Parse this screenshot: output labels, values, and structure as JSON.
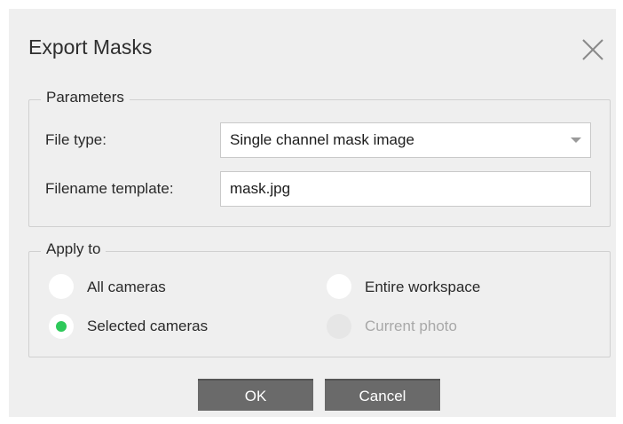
{
  "dialog": {
    "title": "Export Masks",
    "close_icon": "close-icon"
  },
  "parameters": {
    "legend": "Parameters",
    "file_type_label": "File type:",
    "file_type_value": "Single channel mask image",
    "filename_label": "Filename template:",
    "filename_value": "mask.jpg"
  },
  "apply_to": {
    "legend": "Apply to",
    "options": [
      {
        "label": "All cameras",
        "selected": false,
        "enabled": true
      },
      {
        "label": "Entire workspace",
        "selected": false,
        "enabled": true
      },
      {
        "label": "Selected cameras",
        "selected": true,
        "enabled": true
      },
      {
        "label": "Current photo",
        "selected": false,
        "enabled": false
      }
    ]
  },
  "buttons": {
    "ok": "OK",
    "cancel": "Cancel"
  },
  "colors": {
    "dialog_bg": "#efefef",
    "radio_selected": "#2ec95a",
    "button_bg": "#6a6a6a"
  }
}
